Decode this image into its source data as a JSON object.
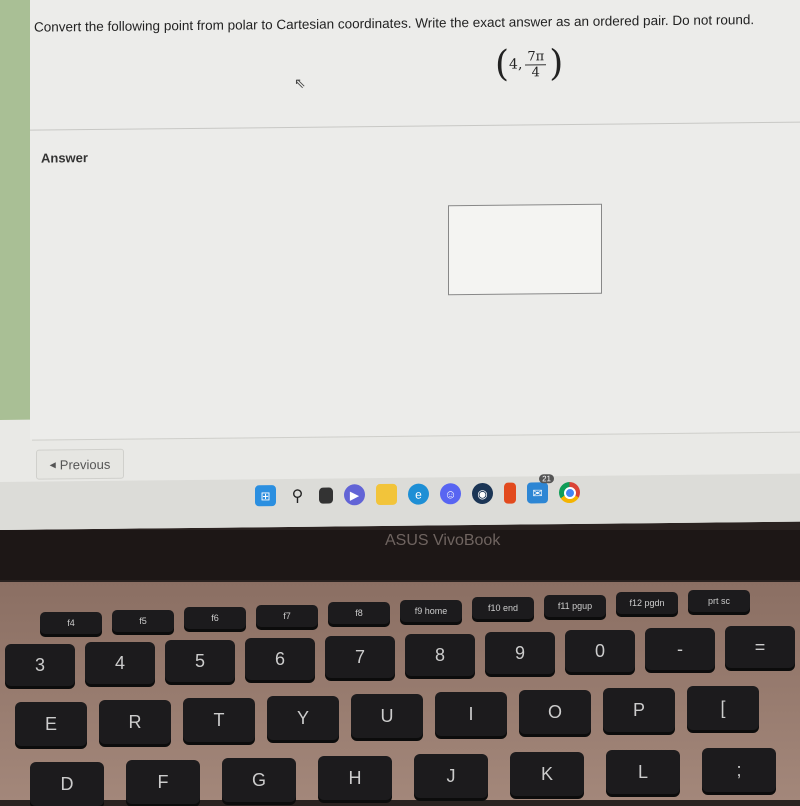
{
  "question": {
    "text": "Convert the following point from polar to Cartesian coordinates. Write the exact answer as an ordered pair. Do not round.",
    "point": {
      "r": "4,",
      "theta_numerator": "7π",
      "theta_denominator": "4"
    }
  },
  "answer": {
    "label": "Answer",
    "value": ""
  },
  "navigation": {
    "previous_label": "Previous"
  },
  "taskbar": {
    "icons": [
      "windows-start",
      "search",
      "task-view",
      "teams-chat",
      "file-explorer",
      "edge",
      "discord",
      "steam",
      "office",
      "mail",
      "chrome"
    ],
    "mail_badge": "21"
  },
  "laptop": {
    "brand": "ASUS VivoBook"
  },
  "keyboard": {
    "fn_row": [
      "f4",
      "f5",
      "f6",
      "f7",
      "f8",
      "f9 home",
      "f10 end",
      "f11 pgup",
      "f12 pgdn",
      "prt sc"
    ],
    "number_row": [
      "3",
      "4",
      "5",
      "6",
      "7",
      "8",
      "9",
      "0",
      "-",
      "="
    ],
    "top_row": [
      "E",
      "R",
      "T",
      "Y",
      "U",
      "I",
      "O",
      "P",
      "["
    ],
    "home_row": [
      "D",
      "F",
      "G",
      "H",
      "J",
      "K",
      "L",
      ";"
    ]
  }
}
